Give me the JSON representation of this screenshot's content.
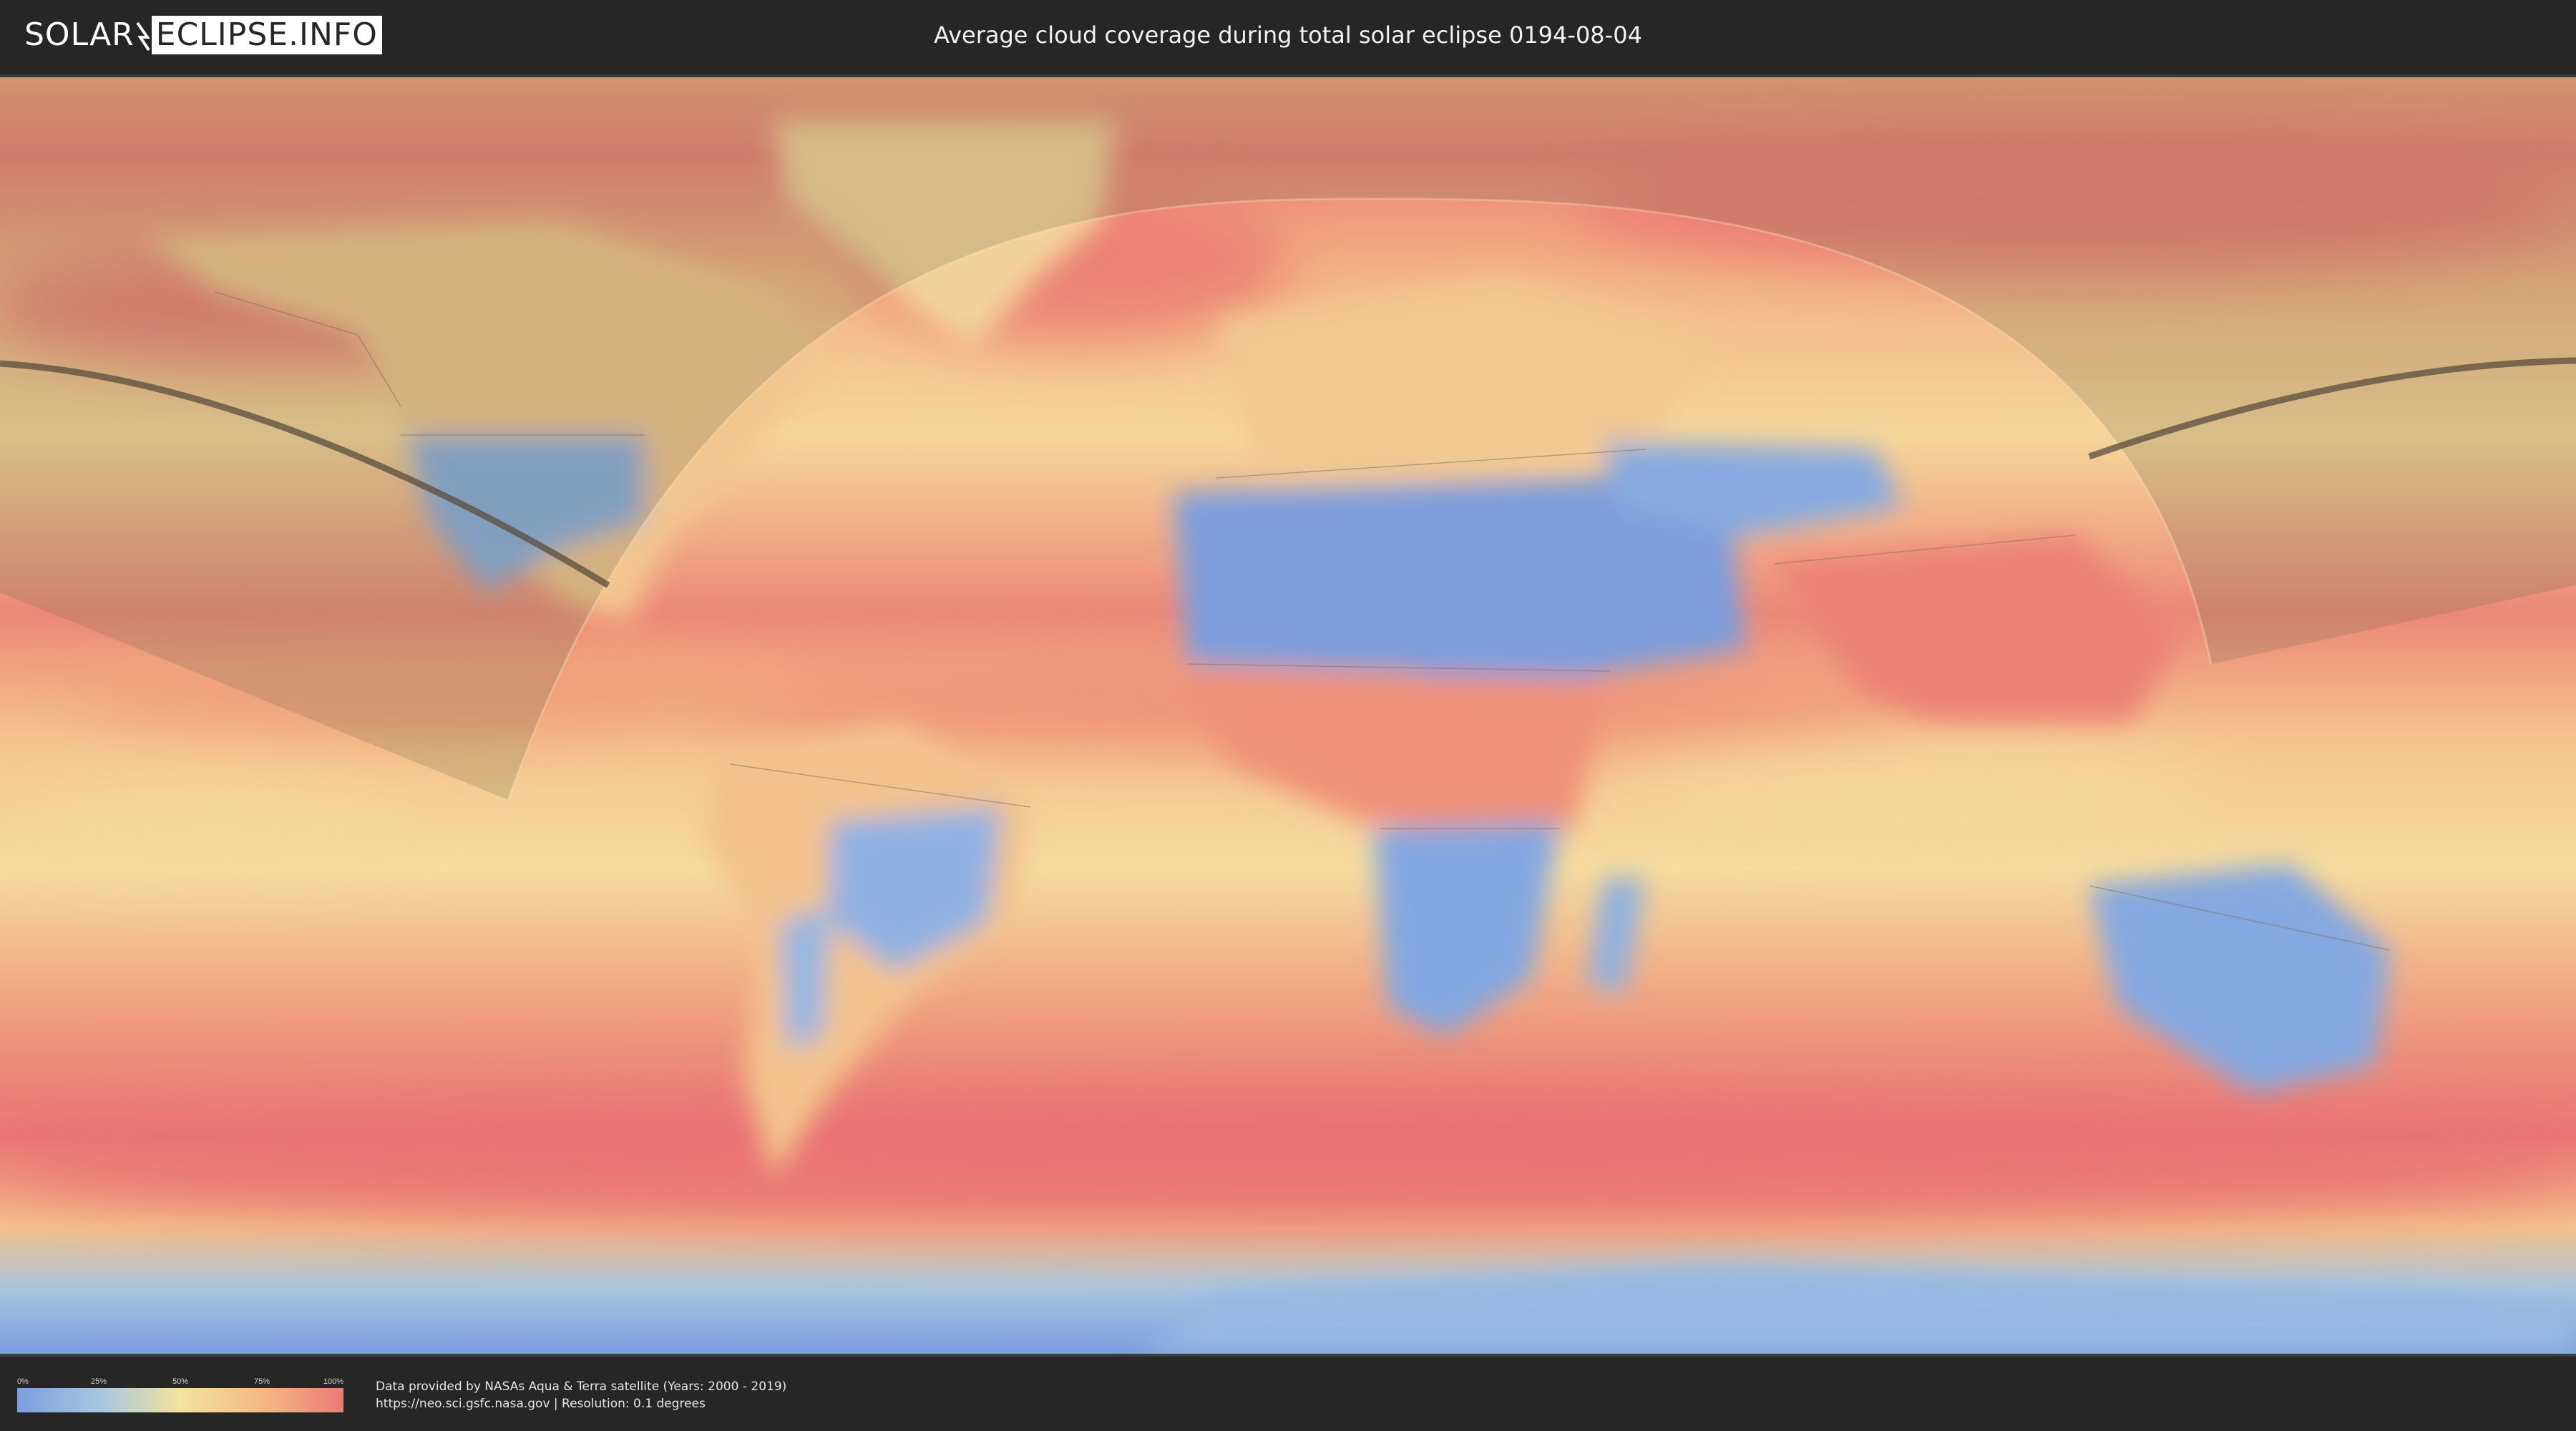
{
  "header": {
    "logo_left": "SOLAR",
    "logo_right": "ECLIPSE.INFO",
    "title": "Average cloud coverage during total solar eclipse 0194-08-04"
  },
  "map": {
    "layers": [
      "cloud-coverage-raster",
      "country-borders",
      "eclipse-visibility-shading",
      "totality-path"
    ],
    "colors": {
      "clear": "#7b9fdc",
      "low": "#a6c6e0",
      "mid": "#f3e2a0",
      "high": "#f4b985",
      "overcast": "#ec7a76",
      "shade": "#6b6b4a"
    }
  },
  "legend": {
    "ticks": [
      "0%",
      "25%",
      "50%",
      "75%",
      "100%"
    ],
    "values": [
      0,
      25,
      50,
      75,
      100
    ]
  },
  "footer": {
    "line1": "Data provided by NASAs Aqua & Terra satellite (Years: 2000 - 2019)",
    "line2": "https://neo.sci.gsfc.nasa.gov | Resolution: 0.1 degrees"
  }
}
